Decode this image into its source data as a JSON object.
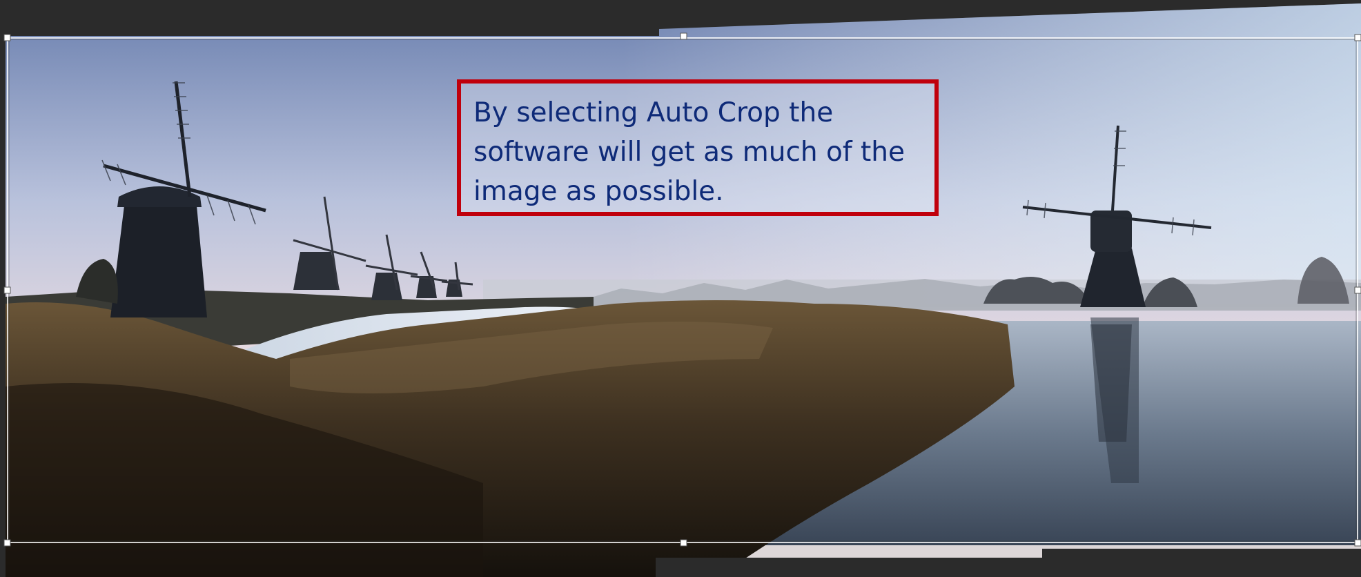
{
  "canvas": {
    "background_color": "#2b2b2b",
    "photo_subject": "panorama of windmills along a canal with reeds in the foreground"
  },
  "crop_tool": {
    "handle_color": "#ffffff",
    "border_color": "#ffffff"
  },
  "callout": {
    "text": "By selecting Auto Crop the\nsoftware will get as much of the\nimage as possible.",
    "border_color": "#c0000c",
    "text_color": "#0e2a78"
  }
}
